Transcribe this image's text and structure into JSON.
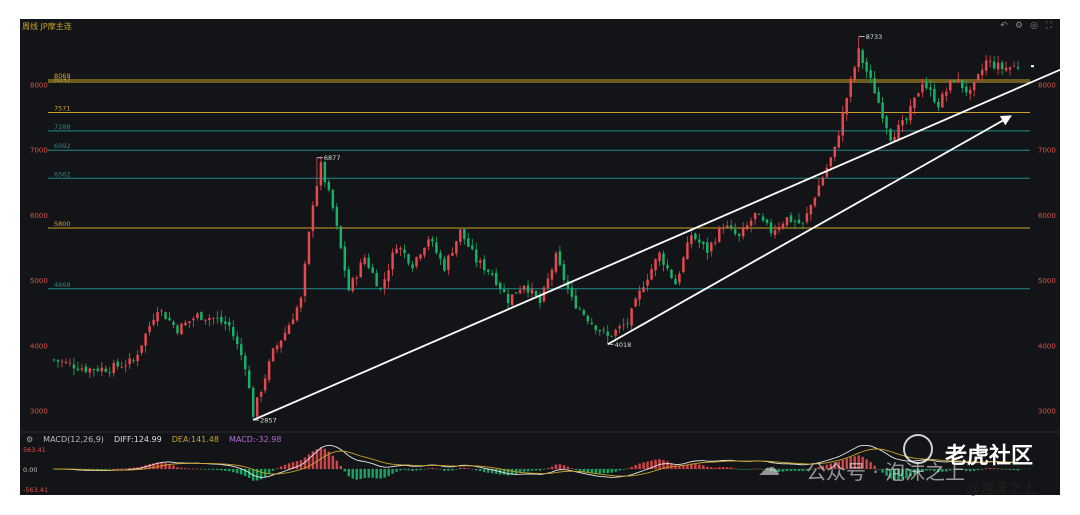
{
  "header": {
    "title": "周线 JP摩主连"
  },
  "toolbar_icons": [
    "undo-icon",
    "settings-icon",
    "circle-icon",
    "fullscreen-icon"
  ],
  "colors": {
    "background": "#131417",
    "up": "#e5484d",
    "down": "#17b26a",
    "yellow_line": "#c9a227",
    "cyan_line": "#1f8a8a",
    "trend": "#ffffff"
  },
  "chart_data": {
    "type": "candlestick",
    "ylim": [
      2750,
      8850
    ],
    "y_ticks": [
      3000,
      4000,
      5000,
      6000,
      7000,
      8000
    ],
    "horizontal_levels": [
      {
        "value": 8069,
        "label": "8069",
        "color": "yellow"
      },
      {
        "value": 8037,
        "label": "8037",
        "color": "yellow"
      },
      {
        "value": 7571,
        "label": "7571",
        "color": "yellow"
      },
      {
        "value": 7288,
        "label": "7288",
        "color": "cyan"
      },
      {
        "value": 6992,
        "label": "6992",
        "color": "cyan"
      },
      {
        "value": 6562,
        "label": "6562",
        "color": "cyan"
      },
      {
        "value": 5800,
        "label": "5800",
        "color": "yellow"
      },
      {
        "value": 4868,
        "label": "4868",
        "color": "cyan"
      }
    ],
    "annotations": [
      {
        "label": "8733",
        "value": 8733,
        "index": 202
      },
      {
        "label": "6877",
        "value": 6877,
        "index": 66
      },
      {
        "label": "4018",
        "value": 4018,
        "index": 139
      },
      {
        "label": "2857",
        "value": 2857,
        "index": 50
      }
    ],
    "trendlines": [
      {
        "from": [
          50,
          2857
        ],
        "to": [
          255,
          8290
        ]
      },
      {
        "from": [
          139,
          4018
        ],
        "to": [
          240,
          7510
        ]
      }
    ],
    "segments": [
      [
        0,
        3780
      ],
      [
        8,
        3640
      ],
      [
        14,
        3650
      ],
      [
        20,
        3760
      ],
      [
        26,
        4580
      ],
      [
        31,
        4250
      ],
      [
        36,
        4460
      ],
      [
        40,
        4420
      ],
      [
        44,
        4300
      ],
      [
        48,
        3700
      ],
      [
        50,
        2950
      ],
      [
        55,
        3900
      ],
      [
        58,
        4200
      ],
      [
        62,
        4700
      ],
      [
        65,
        6200
      ],
      [
        67,
        6750
      ],
      [
        70,
        6100
      ],
      [
        74,
        4850
      ],
      [
        78,
        5350
      ],
      [
        82,
        4850
      ],
      [
        86,
        5550
      ],
      [
        90,
        5250
      ],
      [
        94,
        5650
      ],
      [
        98,
        5200
      ],
      [
        102,
        5750
      ],
      [
        106,
        5300
      ],
      [
        110,
        5100
      ],
      [
        114,
        4700
      ],
      [
        118,
        4950
      ],
      [
        122,
        4650
      ],
      [
        126,
        5350
      ],
      [
        130,
        4700
      ],
      [
        135,
        4350
      ],
      [
        139,
        4130
      ],
      [
        144,
        4350
      ],
      [
        148,
        4950
      ],
      [
        152,
        5400
      ],
      [
        156,
        4950
      ],
      [
        160,
        5700
      ],
      [
        164,
        5450
      ],
      [
        168,
        5850
      ],
      [
        172,
        5650
      ],
      [
        176,
        6000
      ],
      [
        180,
        5750
      ],
      [
        184,
        5950
      ],
      [
        188,
        5850
      ],
      [
        192,
        6450
      ],
      [
        196,
        7000
      ],
      [
        199,
        7800
      ],
      [
        202,
        8500
      ],
      [
        206,
        7900
      ],
      [
        210,
        7200
      ],
      [
        214,
        7450
      ],
      [
        218,
        8050
      ],
      [
        222,
        7700
      ],
      [
        226,
        8100
      ],
      [
        230,
        7850
      ],
      [
        234,
        8350
      ],
      [
        238,
        8250
      ],
      [
        242,
        8280
      ]
    ],
    "macd": {
      "label": "MACD(12,26,9)",
      "diff_label": "DIFF:124.99",
      "dea_label": "DEA:141.48",
      "macd_label": "MACD:-32.98",
      "y_ticks": [
        "563.41",
        "0.00",
        "-563.41"
      ],
      "ylim": [
        -563.41,
        563.41
      ]
    }
  },
  "watermarks": {
    "brand": "老虎社区",
    "public": "公众号 · 泡沫之上",
    "handle": "@泡沫之上"
  }
}
